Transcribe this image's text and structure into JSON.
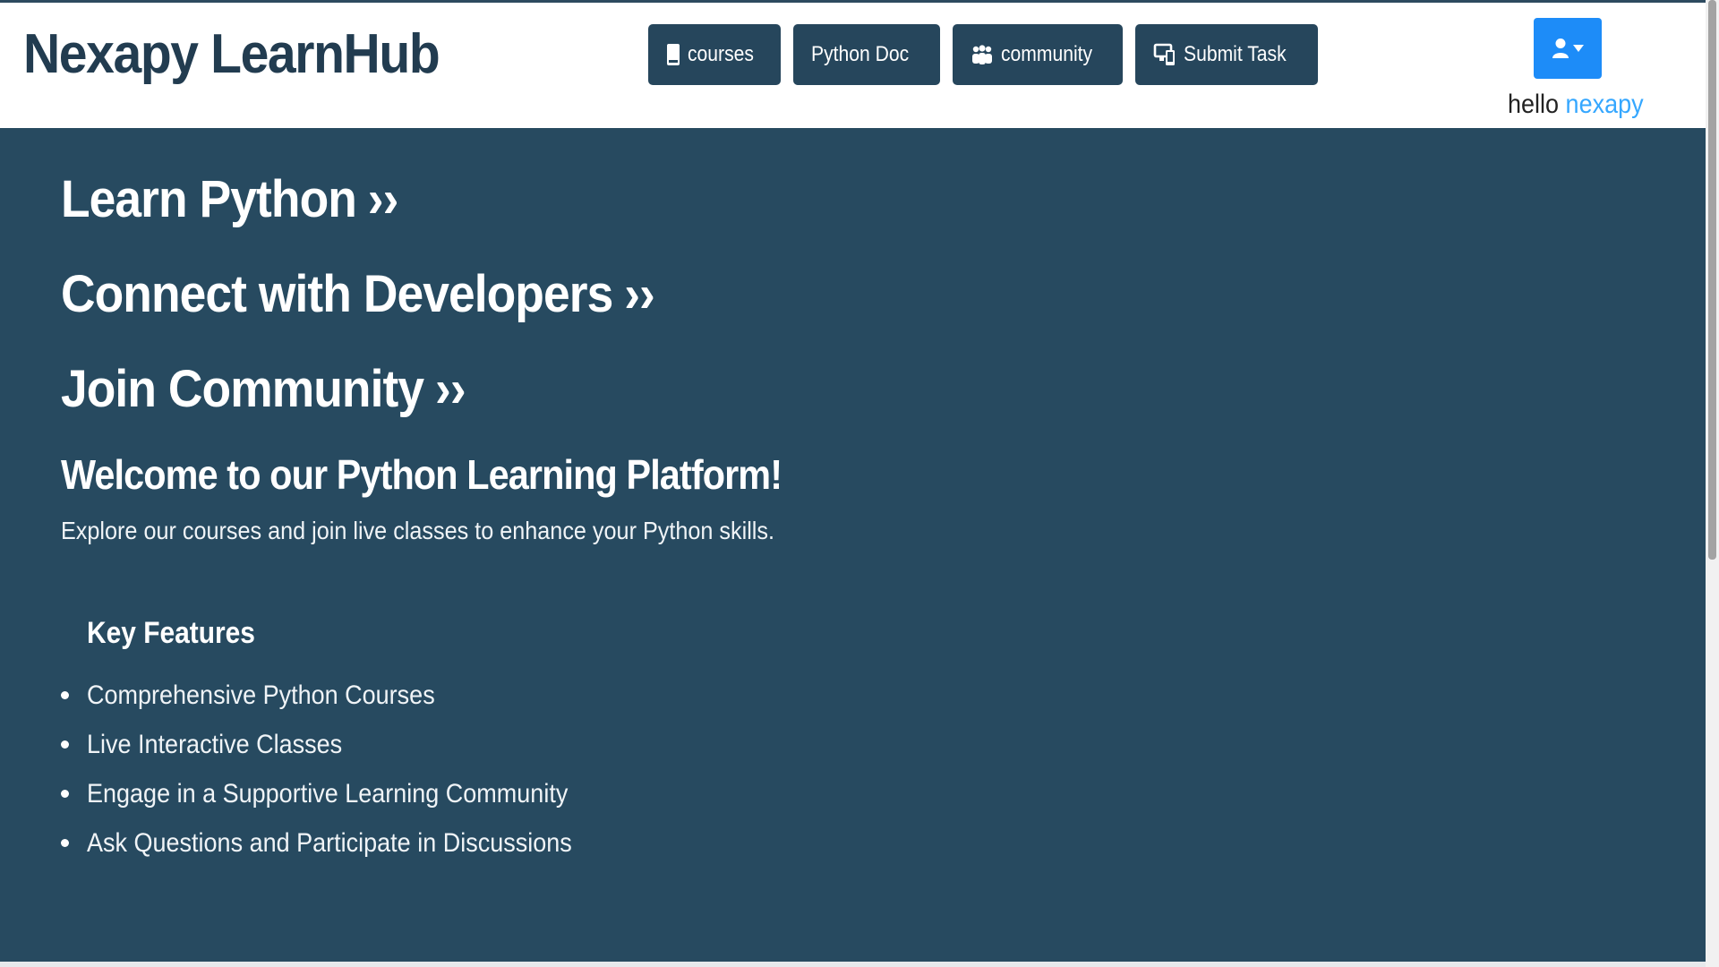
{
  "brand": {
    "name": "Nexapy LearnHub"
  },
  "nav": {
    "courses": {
      "label": "courses",
      "icon": "book-icon"
    },
    "python_doc": {
      "label": "Python Doc"
    },
    "community": {
      "label": "community",
      "icon": "users-icon"
    },
    "submit_task": {
      "label": "Submit Task",
      "icon": "devices-icon"
    }
  },
  "user": {
    "menu_icon": "user-icon",
    "greeting_prefix": "hello",
    "username": "nexapy"
  },
  "hero": {
    "links": [
      {
        "label": "Learn Python",
        "arrows": "››"
      },
      {
        "label": "Connect with Developers",
        "arrows": "››"
      },
      {
        "label": "Join Community",
        "arrows": "››"
      }
    ],
    "welcome": "Welcome to our Python Learning Platform!",
    "intro": "Explore our courses and join live classes to enhance your Python skills."
  },
  "features": {
    "title": "Key Features",
    "items": [
      "Comprehensive Python Courses",
      "Live Interactive Classes",
      "Engage in a Supportive Learning Community",
      "Ask Questions and Participate in Discussions"
    ]
  },
  "colors": {
    "brand_text": "#223c50",
    "nav_button": "#26465c",
    "main_background": "#274a60",
    "user_button": "#1d8cf8",
    "username_text": "#35a7ff"
  }
}
